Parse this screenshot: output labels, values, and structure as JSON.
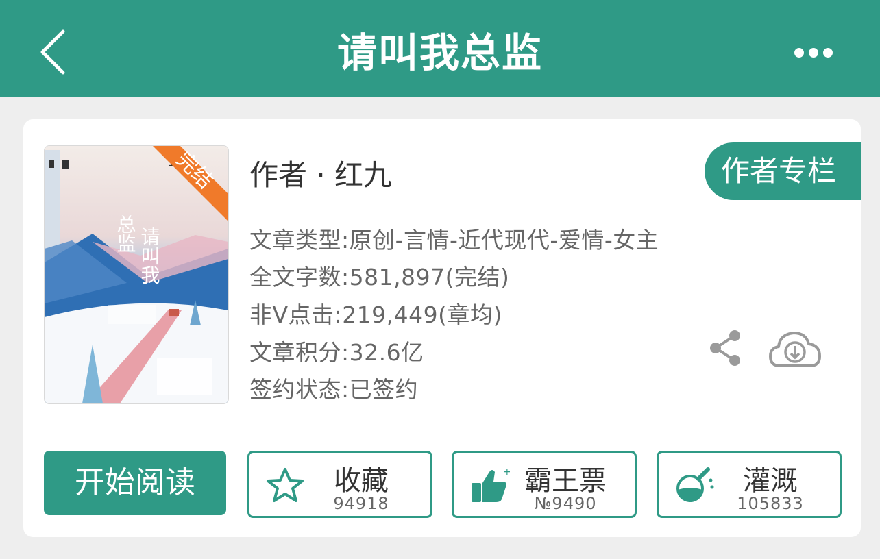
{
  "header": {
    "title": "请叫我总监",
    "back_icon": "chevron-left-icon",
    "more_icon": "more-horizontal-icon"
  },
  "book": {
    "cover": {
      "badge": "完结",
      "title_vertical": [
        "请叫我",
        "总监"
      ]
    },
    "author_line": "作者 · 红九",
    "author_column_label": "作者专栏",
    "info": [
      "文章类型:原创-言情-近代现代-爱情-女主",
      "全文字数:581,897(完结)",
      "非V点击:219,449(章均)",
      "文章积分:32.6亿",
      "签约状态:已签约"
    ]
  },
  "actions": {
    "start_read_label": "开始阅读",
    "favorite": {
      "label": "收藏",
      "count": "94918",
      "icon": "star-icon"
    },
    "vote": {
      "label": "霸王票",
      "count": "№9490",
      "icon": "thumbs-up-icon"
    },
    "nutrient": {
      "label": "灌溉",
      "count": "105833",
      "icon": "flask-icon"
    }
  },
  "colors": {
    "brand": "#2f9a86",
    "badge": "#f07a2a",
    "text_primary": "#333333",
    "text_secondary": "#666666"
  }
}
